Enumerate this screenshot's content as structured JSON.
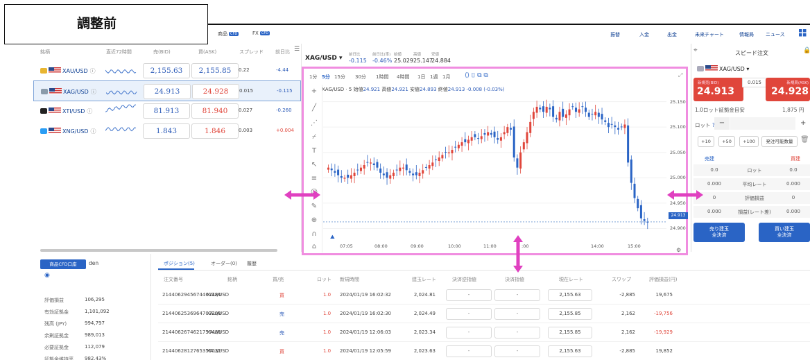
{
  "overlay_label": "調整前",
  "nav": {
    "tabs": [
      {
        "label": "商品",
        "badge": "CFD"
      },
      {
        "label": "FX",
        "badge": "CFD"
      }
    ],
    "links": [
      "振替",
      "入金",
      "出金",
      "未来チャート",
      "情報局",
      "ニュース"
    ]
  },
  "watchlist": {
    "headers": [
      "銘柄",
      "直近72時間",
      "売(BID)",
      "買(ASK)",
      "スプレッド",
      "前日比"
    ],
    "rows": [
      {
        "symbol": "XAU/USD",
        "bid": "2,155.63",
        "ask": "2,155.85",
        "spread": "0.22",
        "change": "-4.44",
        "selected": false
      },
      {
        "symbol": "XAG/USD",
        "bid": "24.913",
        "ask": "24.928",
        "spread": "0.015",
        "change": "-0.115",
        "selected": true
      },
      {
        "symbol": "XTI/USD",
        "bid": "81.913",
        "ask": "81.940",
        "spread": "0.027",
        "change": "-0.260",
        "selected": false
      },
      {
        "symbol": "XNG/USD",
        "bid": "1.843",
        "ask": "1.846",
        "spread": "0.003",
        "change": "+0.004",
        "selected": false
      }
    ],
    "info_icon": "ⓘ"
  },
  "chart_header": {
    "symbol": "XAG/USD",
    "stats": [
      {
        "label": "前日比",
        "value": "-0.115"
      },
      {
        "label": "前日比(率)",
        "value": "-0.46%"
      },
      {
        "label": "始値",
        "value": "25.029"
      },
      {
        "label": "高値",
        "value": "25.147"
      },
      {
        "label": "安値",
        "value": "24.884"
      }
    ]
  },
  "timeframes": [
    "1分",
    "5分",
    "15分",
    "30分",
    "1時間",
    "4時間",
    "1日",
    "1週",
    "1月"
  ],
  "chart_legend": {
    "title": "XAG/USD · 5",
    "items": [
      {
        "label": "始値",
        "value": "24.921"
      },
      {
        "label": "高値",
        "value": "24.921"
      },
      {
        "label": "安値",
        "value": "24.893"
      },
      {
        "label": "終値",
        "value": "24.913 -0.008 (-0.03%)"
      }
    ]
  },
  "chart_data": {
    "type": "candlestick",
    "x_ticks": [
      "07:05",
      "08:00",
      "09:00",
      "10:00",
      "11:00",
      ":00",
      "14:00",
      "15:00"
    ],
    "y_ticks": [
      "25.150",
      "25.100",
      "25.050",
      "25.000",
      "24.950",
      "24.900"
    ],
    "ylim": [
      24.88,
      25.17
    ],
    "last_price": "24.913",
    "closes": [
      25.02,
      25.015,
      25.01,
      25.005,
      25.0,
      25.0,
      25.0,
      25.005,
      25.01,
      25.015,
      25.02,
      25.025,
      25.03,
      25.03,
      25.025,
      25.02,
      25.01,
      25.005,
      25.0,
      25.005,
      25.01,
      25.015,
      25.02,
      25.02,
      25.015,
      25.01,
      25.005,
      25.005,
      25.01,
      25.015,
      25.02,
      25.025,
      25.03,
      25.035,
      25.04,
      25.045,
      25.05,
      25.05,
      25.055,
      25.06,
      25.065,
      25.07,
      25.07,
      25.075,
      25.08,
      25.08,
      25.078,
      25.082,
      25.085,
      25.09,
      25.085,
      25.08,
      25.075,
      25.08,
      25.09,
      25.1,
      25.095,
      25.04,
      25.02,
      25.05,
      25.07,
      25.09,
      25.11,
      25.13,
      25.14,
      25.135,
      25.13,
      25.14,
      25.135,
      25.12,
      25.115,
      25.13,
      25.12,
      25.125,
      25.135,
      25.14,
      25.13,
      25.135,
      25.14,
      25.13,
      25.12,
      25.125,
      25.13,
      25.12,
      25.115,
      25.11,
      25.1,
      25.105,
      25.1,
      25.095,
      25.1,
      25.105,
      25.03,
      24.99,
      24.96,
      24.94,
      24.92,
      24.915,
      24.913
    ],
    "opens_offset": 0.006
  },
  "speed_order": {
    "title": "スピード注文",
    "symbol": "XAG/USD",
    "sell_label": "新規売(BID)",
    "sell_price": "24.913",
    "spread": "0.015",
    "buy_label": "新規買(ASK)",
    "buy_price": "24.928",
    "margin_label": "1.0ロット証拠金目安",
    "margin_value": "1,875 円",
    "lot_label": "ロット",
    "minus": "−",
    "plus": "+",
    "quick_buttons": [
      "+10",
      "+50",
      "+100",
      "発注可能数量"
    ],
    "sell_col": "売建",
    "buy_col": "買建",
    "rows": [
      {
        "left": "0.0",
        "mid": "ロット",
        "right": "0.0"
      },
      {
        "left": "0.000",
        "mid": "平均レート",
        "right": "0.000"
      },
      {
        "left": "0",
        "mid": "評価損益",
        "right": "0"
      },
      {
        "left": "0.000",
        "mid": "損益(レート差)",
        "right": "0.000"
      }
    ],
    "close_sell": [
      "売り建玉",
      "全決済"
    ],
    "close_buy": [
      "買い建玉",
      "全決済"
    ]
  },
  "account": {
    "tab": "商品CFD口座",
    "user": "den",
    "rows": [
      {
        "label": "評価損益",
        "value": "106,295"
      },
      {
        "label": "有効証拠金",
        "value": "1,101,092"
      },
      {
        "label": "残高 (JPY)",
        "value": "994,797"
      },
      {
        "label": "余剰証拠金",
        "value": "989,013"
      },
      {
        "label": "必要証拠金",
        "value": "112,079"
      },
      {
        "label": "証拠金維持率",
        "value": "982.43%"
      }
    ]
  },
  "positions": {
    "tabs": [
      "ポジション(5)",
      "オーダー(0)",
      "履歴"
    ],
    "headers": [
      "注文番号",
      "銘柄",
      "買/売",
      "ロット",
      "新規時間",
      "建玉レート",
      "決済逆指値",
      "決済指値",
      "現在レート",
      "スワップ",
      "評価損益(円)"
    ],
    "rows": [
      {
        "id": "2144062945674461184",
        "symbol": "XAU/USD",
        "side": "買",
        "lot": "1.0",
        "time": "2024/01/19 16:02:32",
        "rate": "2,024.81",
        "stop": "-",
        "limit": "-",
        "current": "2,155.63",
        "swap": "-2,885",
        "pl": "19,675"
      },
      {
        "id": "2144062536964702208",
        "symbol": "XAU/USD",
        "side": "売",
        "lot": "1.0",
        "time": "2024/01/19 16:02:30",
        "rate": "2,024.49",
        "stop": "-",
        "limit": "-",
        "current": "2,155.85",
        "swap": "2,162",
        "pl": "-19,756"
      },
      {
        "id": "2144062674621759488",
        "symbol": "XAU/USD",
        "side": "売",
        "lot": "1.0",
        "time": "2024/01/19 12:06:03",
        "rate": "2,023.34",
        "stop": "-",
        "limit": "-",
        "current": "2,155.85",
        "swap": "2,162",
        "pl": "-19,929"
      },
      {
        "id": "2144062812765356032",
        "symbol": "XAU/USD",
        "side": "買",
        "lot": "1.0",
        "time": "2024/01/19 12:05:59",
        "rate": "2,023.63",
        "stop": "-",
        "limit": "-",
        "current": "2,155.63",
        "swap": "-2,885",
        "pl": "19,852"
      }
    ]
  },
  "colors": {
    "accent": "#2a64c5",
    "sell": "#e0463b",
    "highlight": "#f08de0",
    "arrow": "#e040c0"
  }
}
